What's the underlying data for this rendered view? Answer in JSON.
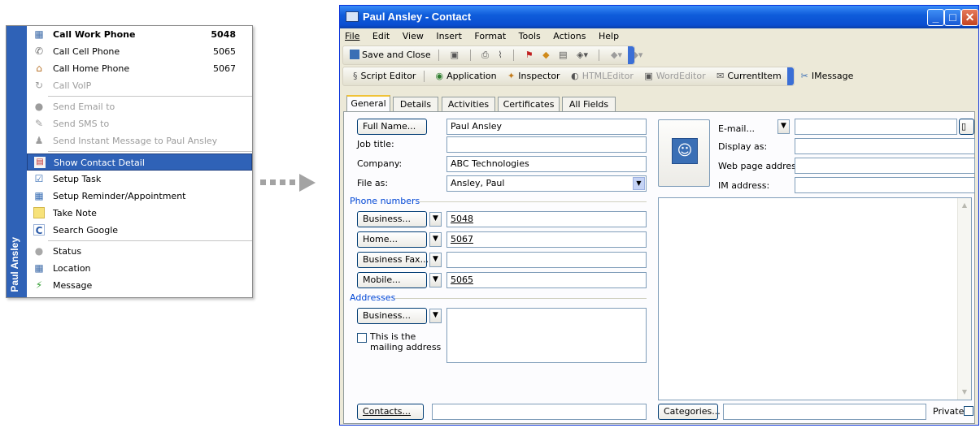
{
  "context_menu": {
    "side_label": "Paul Ansley",
    "items": [
      {
        "label": "Call Work Phone",
        "number": "5048",
        "icon": "phone-grid-icon"
      },
      {
        "label": "Call Cell Phone",
        "number": "5065",
        "icon": "cell-phone-icon"
      },
      {
        "label": "Call Home Phone",
        "number": "5067",
        "icon": "home-icon"
      },
      {
        "label": "Call VoIP",
        "icon": "voip-icon"
      },
      {
        "label": "Send Email to",
        "icon": "email-icon"
      },
      {
        "label": "Send SMS to",
        "icon": "sms-icon"
      },
      {
        "label": "Send Instant Message to Paul Ansley",
        "icon": "im-person-icon"
      },
      {
        "label": "Show Contact Detail",
        "icon": "contact-card-icon"
      },
      {
        "label": "Setup Task",
        "icon": "task-icon"
      },
      {
        "label": "Setup Reminder/Appointment",
        "icon": "calendar-icon"
      },
      {
        "label": "Take Note",
        "icon": "note-icon"
      },
      {
        "label": "Search Google",
        "icon": "google-icon"
      },
      {
        "label": "Status",
        "icon": "status-dot-icon"
      },
      {
        "label": "Location",
        "icon": "location-grid-icon"
      },
      {
        "label": "Message",
        "icon": "lightning-icon"
      }
    ]
  },
  "window": {
    "title": "Paul Ansley - Contact",
    "menu": [
      "File",
      "Edit",
      "View",
      "Insert",
      "Format",
      "Tools",
      "Actions",
      "Help"
    ],
    "toolbar1": {
      "save_close": "Save and Close"
    },
    "toolbar2": {
      "script_editor": "Script Editor",
      "application": "Application",
      "inspector": "Inspector",
      "html_editor": "HTMLEditor",
      "word_editor": "WordEditor",
      "current_item": "CurrentItem",
      "imessage": "IMessage"
    },
    "tabs": [
      "General",
      "Details",
      "Activities",
      "Certificates",
      "All Fields"
    ],
    "form": {
      "full_name_btn": "Full Name...",
      "full_name": "Paul Ansley",
      "job_title_label": "Job title:",
      "job_title": "",
      "company_label": "Company:",
      "company": "ABC Technologies",
      "file_as_label": "File as:",
      "file_as": "Ansley, Paul",
      "phone_group": "Phone numbers",
      "phones": [
        {
          "type": "Business...",
          "value": "5048"
        },
        {
          "type": "Home...",
          "value": "5067"
        },
        {
          "type": "Business Fax...",
          "value": ""
        },
        {
          "type": "Mobile...",
          "value": "5065"
        }
      ],
      "address_group": "Addresses",
      "address_type": "Business...",
      "address": "",
      "mailing_checkbox": "This is the mailing address",
      "email_label": "E-mail...",
      "email": "",
      "display_as_label": "Display as:",
      "display_as": "",
      "web_label": "Web page address:",
      "web": "",
      "im_label": "IM address:",
      "im": "",
      "contacts_btn": "Contacts...",
      "contacts": "",
      "categories_btn": "Categories...",
      "categories": "",
      "private_label": "Private"
    }
  }
}
